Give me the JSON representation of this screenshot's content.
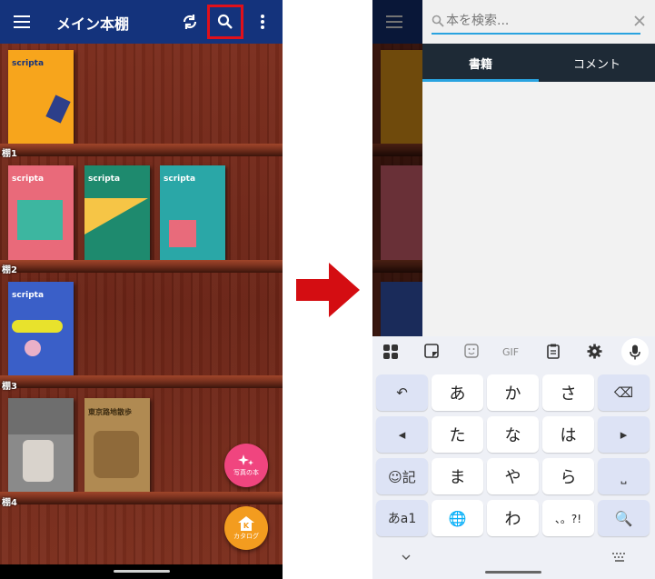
{
  "left_screen": {
    "app_title": "メイン本棚",
    "shelves": [
      {
        "label": "棚1",
        "books": [
          {
            "title": "scripta",
            "color": "#f7a51c"
          }
        ]
      },
      {
        "label": "棚2",
        "books": [
          {
            "title": "scripta",
            "color": "#e96a7a"
          },
          {
            "title": "scripta",
            "color": "#1e8a6e"
          },
          {
            "title": "scripta",
            "color": "#2aa7a7"
          }
        ]
      },
      {
        "label": "棚3",
        "books": [
          {
            "title": "scripta",
            "color": "#3a5fc8"
          }
        ]
      },
      {
        "label": "棚4",
        "books": [
          {
            "title": "",
            "color": "#8a8a8a"
          },
          {
            "title": "東京路地散歩",
            "color": "#b08a52"
          }
        ]
      }
    ],
    "fab_recommend": "写真の本",
    "fab_catalog": "カタログ",
    "colors": {
      "appbar": "#14337c",
      "highlight": "#e0101a",
      "fab_pink": "#f0457f",
      "fab_orange": "#f39c1f"
    }
  },
  "right_screen": {
    "search_placeholder": "本を検索...",
    "tabs": [
      {
        "label": "書籍",
        "active": true
      },
      {
        "label": "コメント",
        "active": false
      }
    ],
    "keyboard_toolbar": [
      "apps-icon",
      "sticker-icon",
      "emoji-icon",
      "GIF",
      "clipboard-icon",
      "settings-icon",
      "mic-icon"
    ],
    "keyboard_rows": [
      [
        "↶",
        "あ",
        "か",
        "さ",
        "⌫"
      ],
      [
        "◂",
        "た",
        "な",
        "は",
        "▸"
      ],
      [
        "☺記",
        "ま",
        "や",
        "ら",
        "⎵"
      ],
      [
        "あa1",
        "🌐",
        "わ",
        "、。?!",
        "🔍"
      ]
    ],
    "colors": {
      "accent": "#29a3e0",
      "tabs_bg": "#1e2a36"
    }
  }
}
